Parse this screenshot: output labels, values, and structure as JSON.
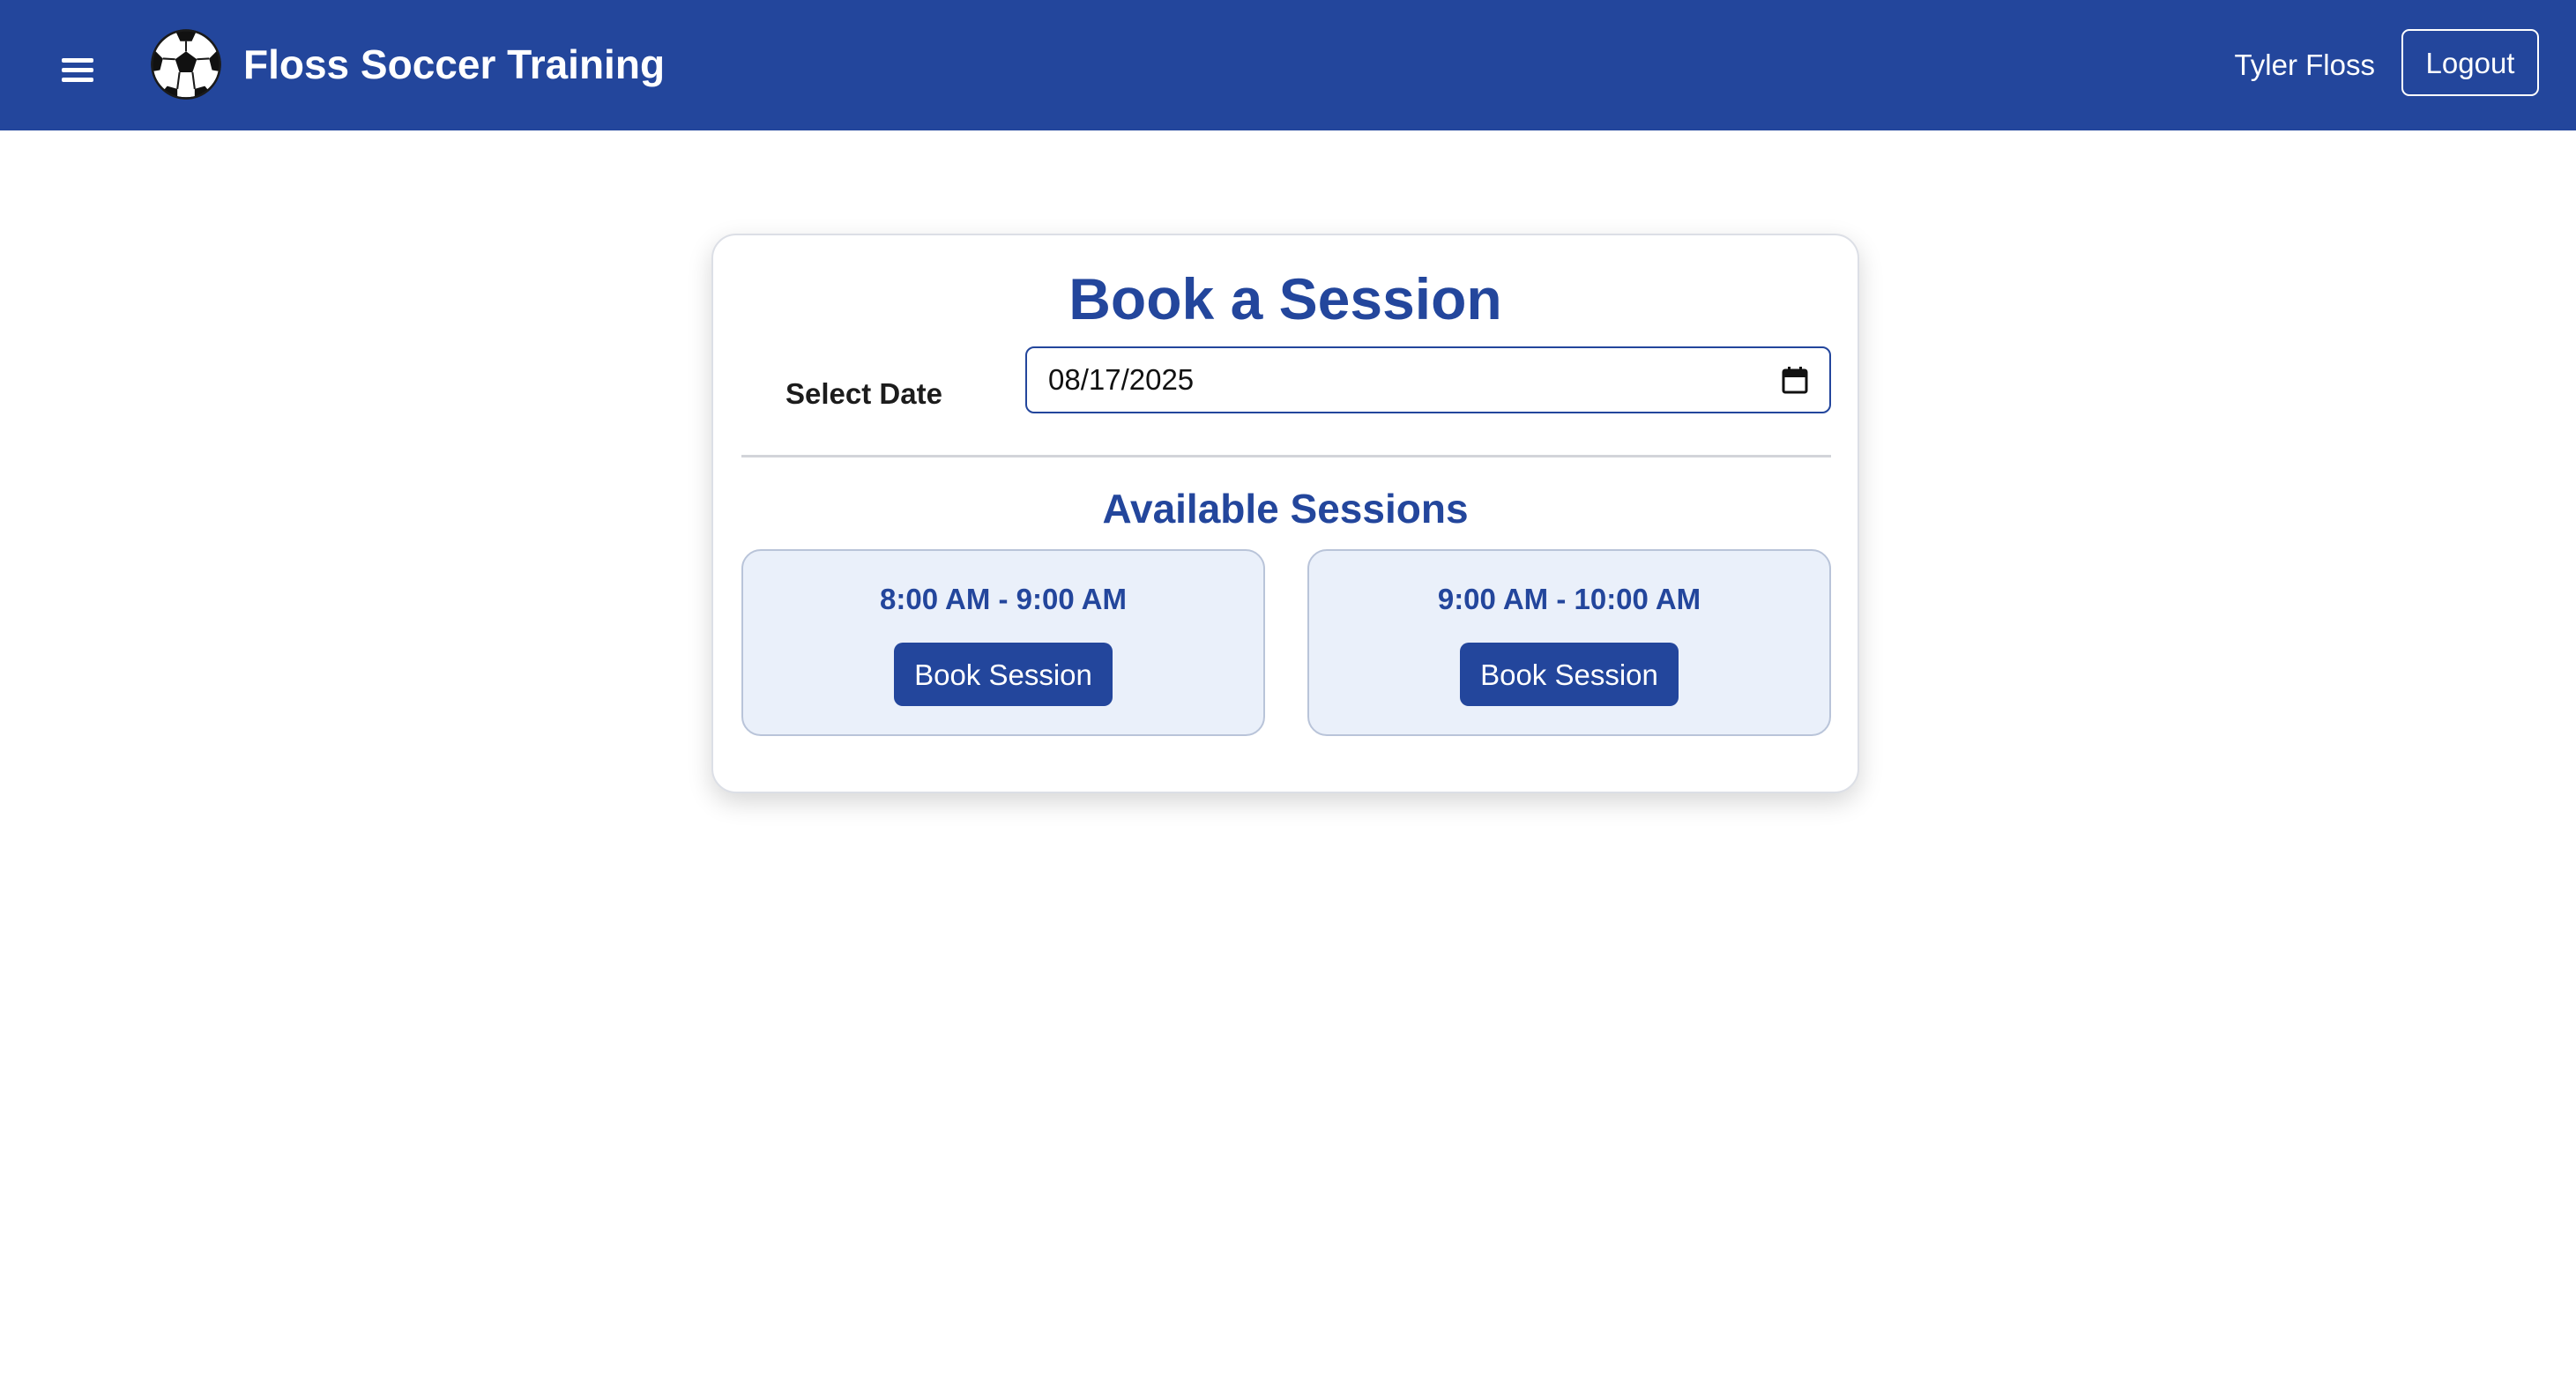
{
  "navbar": {
    "menu_icon": "hamburger-menu-icon",
    "logo_icon": "soccer-ball-icon",
    "brand": "Floss Soccer Training",
    "user_name": "Tyler Floss",
    "logout_label": "Logout",
    "background_color": "#23469c"
  },
  "booking": {
    "title": "Book a Session",
    "date_label": "Select Date",
    "date_value": "08/17/2025",
    "calendar_icon": "calendar-icon",
    "sessions_title": "Available Sessions",
    "sessions": [
      {
        "time": "8:00 AM - 9:00 AM",
        "button_label": "Book Session"
      },
      {
        "time": "9:00 AM - 10:00 AM",
        "button_label": "Book Session"
      }
    ],
    "accent_color": "#23469c",
    "slot_background": "#eaf0fa"
  }
}
